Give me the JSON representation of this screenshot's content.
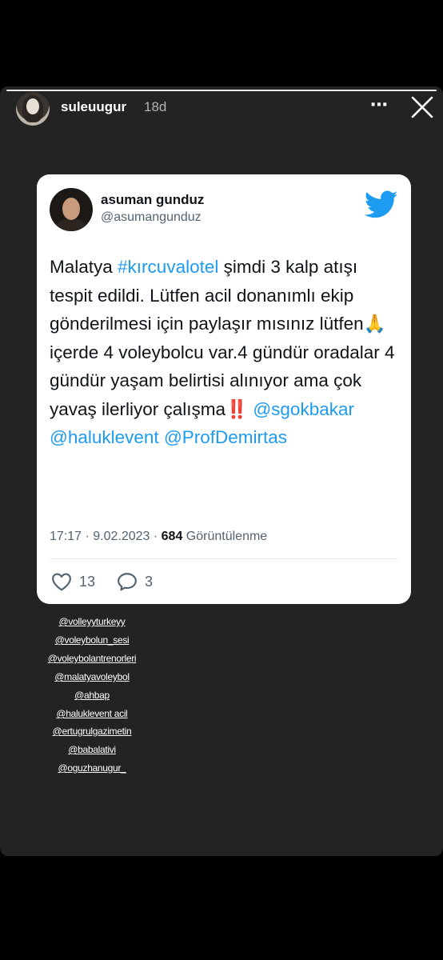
{
  "story": {
    "username": "suleuugur",
    "time": "18d",
    "more_icon": "⋯",
    "progress": 1.0
  },
  "tweet": {
    "display_name": "asuman gunduz",
    "handle": "@asumangunduz",
    "text_segments": [
      {
        "text": "Malatya ",
        "link": false
      },
      {
        "text": "#kırcuvalotel",
        "link": true
      },
      {
        "text": " şimdi 3 kalp atışı tespit edildi. Lütfen acil donanımlı ekip gönderilmesi için paylaşır mısınız lütfen🙏 içerde 4 voleybolcu var.4 gündür oradalar 4 gündür yaşam belirtisi alınıyor ama çok yavaş ilerliyor çalışma‼️ ",
        "link": false
      },
      {
        "text": "@sgokbakar",
        "link": true
      },
      {
        "text": " ",
        "link": false
      },
      {
        "text": "@haluklevent",
        "link": true
      },
      {
        "text": " ",
        "link": false
      },
      {
        "text": "@ProfDemirtas",
        "link": true
      }
    ],
    "timestamp": "17:17 · 9.02.2023 · ",
    "views_count": "684",
    "views_label": " Görüntülenme",
    "like_count": "13",
    "reply_count": "3",
    "brand_color": "#1d9bf0"
  },
  "mentions": [
    "@volleyyturkeyy",
    "@voleybolun_sesi",
    "@voleybolantrenorleri",
    "@malatyavoleybol",
    "@ahbap",
    "@haluklevent acil",
    "@ertugrulgazimetin",
    "@babalativi",
    "@oguzhanugur_"
  ]
}
